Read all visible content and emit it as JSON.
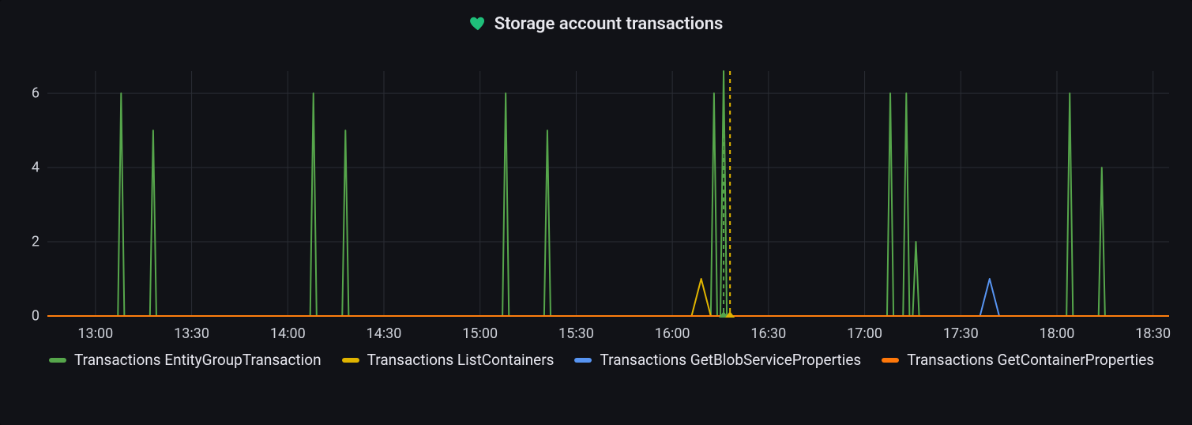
{
  "title": "Storage account transactions",
  "icon": "heart-icon",
  "colors": {
    "green": "#56a64b",
    "yellow": "#e0b400",
    "blue": "#5794f2",
    "orange": "#ff780a",
    "grid": "#2a2d34",
    "text": "#cfd2da",
    "ann_green": "#56a64b",
    "ann_yellow": "#e0b400"
  },
  "chart_data": {
    "type": "line",
    "title": "Storage account transactions",
    "xlabel": "",
    "ylabel": "",
    "x_range_minutes": [
      765,
      1115
    ],
    "x_ticks_minutes": [
      780,
      810,
      840,
      870,
      900,
      930,
      960,
      990,
      1020,
      1050,
      1080,
      1110
    ],
    "x_tick_labels": [
      "13:00",
      "13:30",
      "14:00",
      "14:30",
      "15:00",
      "15:30",
      "16:00",
      "16:30",
      "17:00",
      "17:30",
      "18:00",
      "18:30"
    ],
    "ylim": [
      0,
      6.6
    ],
    "y_ticks": [
      0,
      2,
      4,
      6
    ],
    "grid": true,
    "legend_position": "bottom",
    "annotations": [
      {
        "x_min": 976,
        "color_key": "ann_green",
        "style": "dashed-vertical"
      },
      {
        "x_min": 978,
        "color_key": "ann_yellow",
        "style": "dashed-vertical"
      }
    ],
    "series": [
      {
        "name": "Transactions EntityGroupTransaction",
        "color_key": "green",
        "points": [
          {
            "x_min": 765,
            "y": 0
          },
          {
            "x_min": 787,
            "y": 0
          },
          {
            "x_min": 788,
            "y": 6
          },
          {
            "x_min": 789,
            "y": 0
          },
          {
            "x_min": 797,
            "y": 0
          },
          {
            "x_min": 798,
            "y": 5
          },
          {
            "x_min": 799,
            "y": 0
          },
          {
            "x_min": 847,
            "y": 0
          },
          {
            "x_min": 848,
            "y": 6
          },
          {
            "x_min": 849,
            "y": 0
          },
          {
            "x_min": 857,
            "y": 0
          },
          {
            "x_min": 858,
            "y": 5
          },
          {
            "x_min": 859,
            "y": 0
          },
          {
            "x_min": 907,
            "y": 0
          },
          {
            "x_min": 908,
            "y": 6
          },
          {
            "x_min": 909,
            "y": 0
          },
          {
            "x_min": 920,
            "y": 0
          },
          {
            "x_min": 921,
            "y": 5
          },
          {
            "x_min": 922,
            "y": 0
          },
          {
            "x_min": 972,
            "y": 0
          },
          {
            "x_min": 973,
            "y": 6
          },
          {
            "x_min": 974,
            "y": 0
          },
          {
            "x_min": 975,
            "y": 0
          },
          {
            "x_min": 976,
            "y": 6.6
          },
          {
            "x_min": 977,
            "y": 0
          },
          {
            "x_min": 1027,
            "y": 0
          },
          {
            "x_min": 1028,
            "y": 6
          },
          {
            "x_min": 1029,
            "y": 0
          },
          {
            "x_min": 1032,
            "y": 0
          },
          {
            "x_min": 1033,
            "y": 6
          },
          {
            "x_min": 1034,
            "y": 0
          },
          {
            "x_min": 1035,
            "y": 0
          },
          {
            "x_min": 1036,
            "y": 2
          },
          {
            "x_min": 1037,
            "y": 0
          },
          {
            "x_min": 1083,
            "y": 0
          },
          {
            "x_min": 1084,
            "y": 6
          },
          {
            "x_min": 1085,
            "y": 0
          },
          {
            "x_min": 1093,
            "y": 0
          },
          {
            "x_min": 1094,
            "y": 4
          },
          {
            "x_min": 1095,
            "y": 0
          },
          {
            "x_min": 1115,
            "y": 0
          }
        ]
      },
      {
        "name": "Transactions ListContainers",
        "color_key": "yellow",
        "points": [
          {
            "x_min": 765,
            "y": 0
          },
          {
            "x_min": 966,
            "y": 0
          },
          {
            "x_min": 969,
            "y": 1
          },
          {
            "x_min": 972,
            "y": 0
          },
          {
            "x_min": 1115,
            "y": 0
          }
        ]
      },
      {
        "name": "Transactions GetBlobServiceProperties",
        "color_key": "blue",
        "points": [
          {
            "x_min": 765,
            "y": 0
          },
          {
            "x_min": 1056,
            "y": 0
          },
          {
            "x_min": 1059,
            "y": 1
          },
          {
            "x_min": 1062,
            "y": 0
          },
          {
            "x_min": 1115,
            "y": 0
          }
        ]
      },
      {
        "name": "Transactions GetContainerProperties",
        "color_key": "orange",
        "points": [
          {
            "x_min": 765,
            "y": 0
          },
          {
            "x_min": 1115,
            "y": 0
          }
        ]
      }
    ]
  }
}
